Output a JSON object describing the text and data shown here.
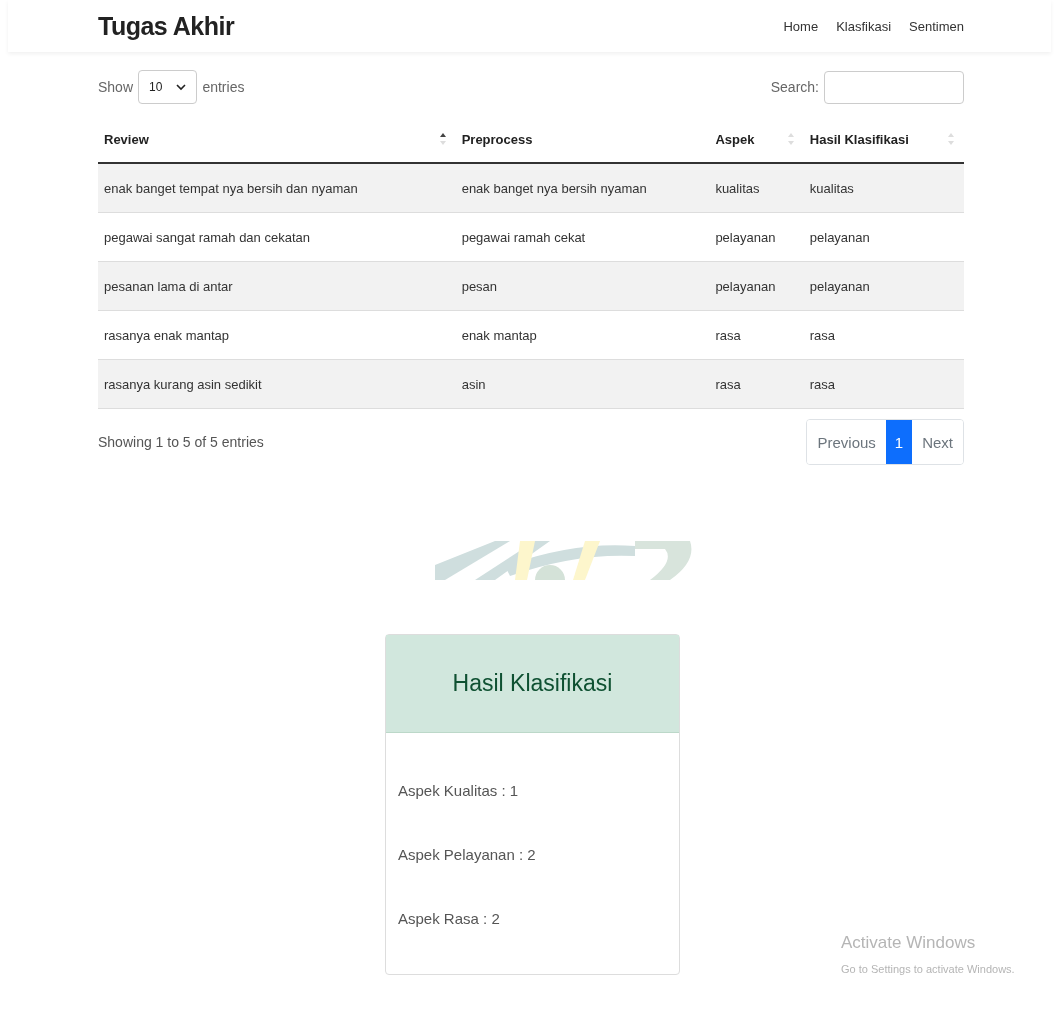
{
  "navbar": {
    "brand": "Tugas Akhir",
    "links": [
      "Home",
      "Klasfikasi",
      "Sentimen"
    ]
  },
  "table_controls": {
    "show_label": "Show",
    "page_size": "10",
    "entries_label": "entries",
    "search_label": "Search:"
  },
  "table": {
    "columns": [
      {
        "label": "Review",
        "sortable": true,
        "sorted": true
      },
      {
        "label": "Preprocess",
        "sortable": false
      },
      {
        "label": "Aspek",
        "sortable": true,
        "sorted": false
      },
      {
        "label": "Hasil Klasifikasi",
        "sortable": true,
        "sorted": false
      }
    ],
    "rows": [
      [
        "enak banget tempat nya bersih dan nyaman",
        "enak banget nya bersih nyaman",
        "kualitas",
        "kualitas"
      ],
      [
        "pegawai sangat ramah dan cekatan",
        "pegawai ramah cekat",
        "pelayanan",
        "pelayanan"
      ],
      [
        "pesanan lama di antar",
        "pesan",
        "pelayanan",
        "pelayanan"
      ],
      [
        "rasanya enak mantap",
        "enak mantap",
        "rasa",
        "rasa"
      ],
      [
        "rasanya kurang asin sedikit",
        "asin",
        "rasa",
        "rasa"
      ]
    ]
  },
  "table_info": "Showing 1 to 5 of 5 entries",
  "pagination": [
    {
      "label": "Previous",
      "selected": false
    },
    {
      "label": "1",
      "selected": true
    },
    {
      "label": "Next",
      "selected": false
    }
  ],
  "card": {
    "title": "Hasil Klasifikasi",
    "items": [
      "Aspek Kualitas : 1",
      "Aspek Pelayanan : 2",
      "Aspek Rasa : 2"
    ]
  },
  "activation_notice": {
    "title": "Activate Windows",
    "message": "Go to Settings to activate Windows."
  }
}
